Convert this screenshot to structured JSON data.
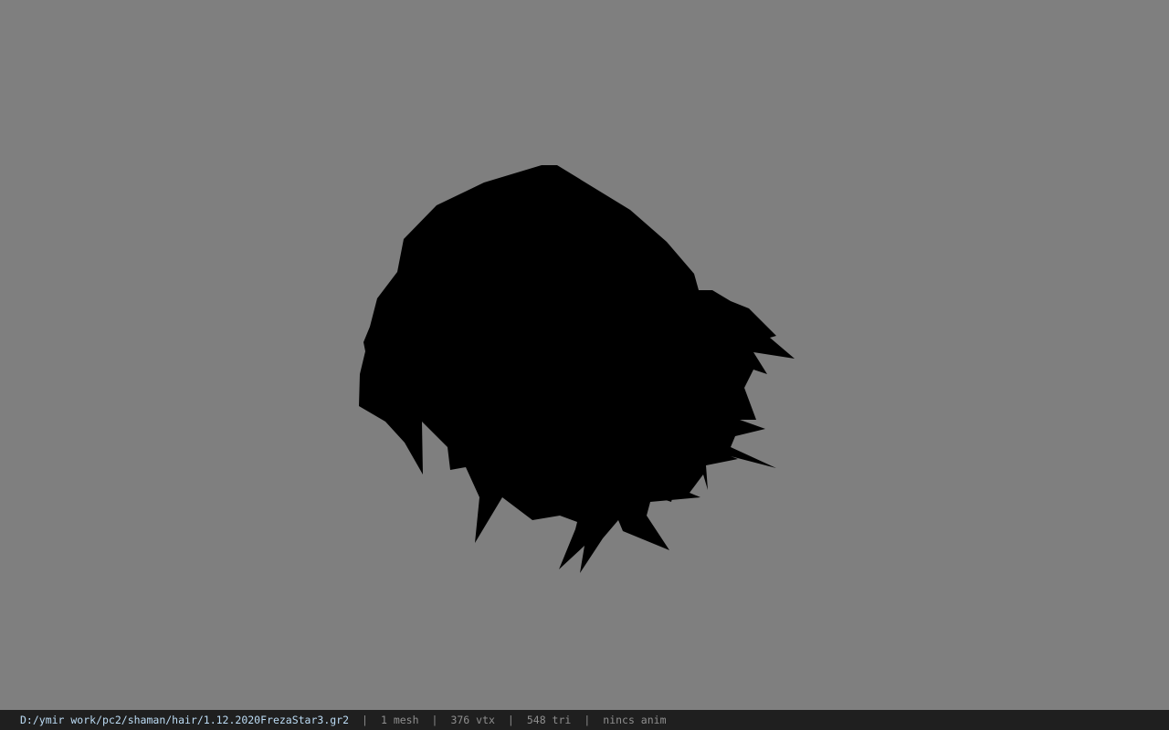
{
  "viewport": {
    "background_color": "#7f7f7f",
    "model_color": "#000000",
    "model_name": "hair-mesh-silhouette"
  },
  "statusbar": {
    "file_path": "D:/ymir work/pc2/shaman/hair/1.12.2020FrezaStar3.gr2",
    "separator": "|",
    "mesh_count": "1 mesh",
    "vertex_count": "376 vtx",
    "triangle_count": "548 tri",
    "anim_info": "nincs anim",
    "path_color": "#bcdcf5",
    "background_color": "#1f1f1f"
  }
}
